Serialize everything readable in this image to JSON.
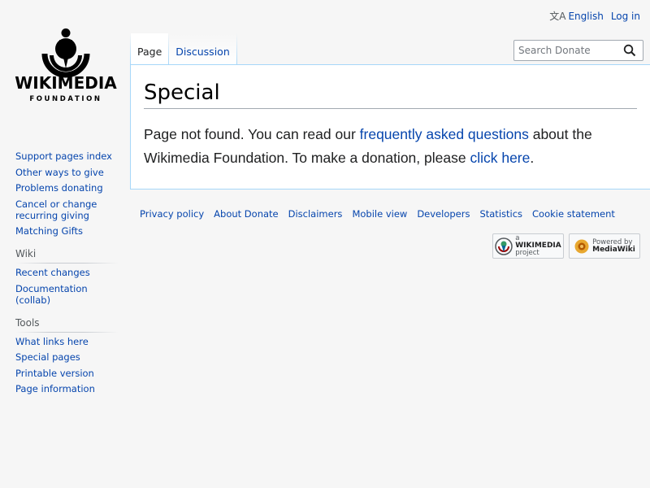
{
  "personal": {
    "language": "English",
    "login": "Log in"
  },
  "logo": {
    "name": "WIKIMEDIA",
    "tagline": "FOUNDATION"
  },
  "tabs": [
    {
      "label": "Page",
      "selected": true
    },
    {
      "label": "Discussion",
      "selected": false
    }
  ],
  "search": {
    "placeholder": "Search Donate",
    "icon": "search-icon"
  },
  "main": {
    "title": "Special",
    "text_before": "Page not found. You can read our ",
    "link1": "frequently asked questions",
    "text_middle": " about the Wikimedia Foundation. To make a donation, please ",
    "link2": "click here",
    "text_after": "."
  },
  "sidebar": {
    "navigation": [
      "Support pages index",
      "Other ways to give",
      "Problems donating",
      "Cancel or change recurring giving",
      "Matching Gifts"
    ],
    "wiki": {
      "heading": "Wiki",
      "items": [
        "Recent changes",
        "Documentation (collab)"
      ]
    },
    "tools": {
      "heading": "Tools",
      "items": [
        "What links here",
        "Special pages",
        "Printable version",
        "Page information"
      ]
    }
  },
  "footer": {
    "links": [
      "Privacy policy",
      "About Donate",
      "Disclaimers",
      "Mobile view",
      "Developers",
      "Statistics",
      "Cookie statement"
    ],
    "badge_wikimedia": {
      "small": "a",
      "big": "WIKIMEDIA",
      "sub": "project"
    },
    "badge_mediawiki": {
      "small": "Powered by",
      "big": "MediaWiki"
    }
  },
  "colors": {
    "link": "#0645ad",
    "border": "#a7d7f9",
    "background": "#f6f6f6"
  }
}
